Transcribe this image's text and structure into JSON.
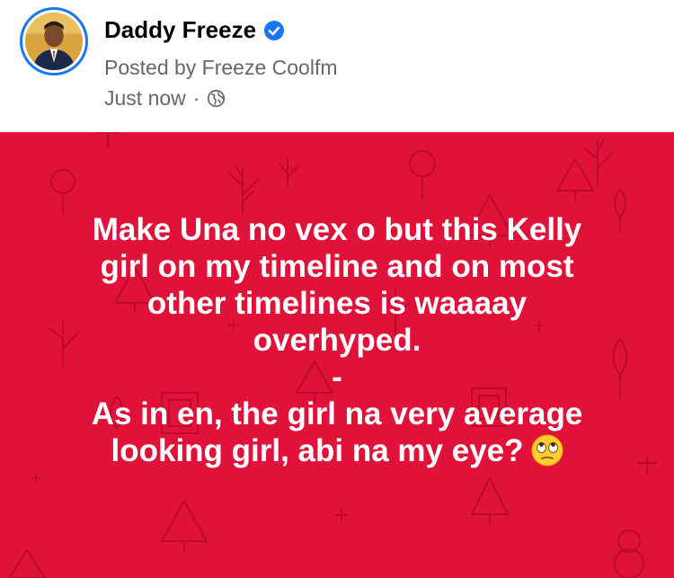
{
  "author": {
    "name": "Daddy Freeze",
    "verified": true,
    "posted_by": "Posted by Freeze Coolfm",
    "time": "Just now",
    "separator": "·",
    "audience_icon": "globe-icon"
  },
  "post": {
    "background_color": "#e0123a",
    "text_color": "#ffffff",
    "lines": [
      "Make Una no vex o but this Kelly",
      "girl on my timeline and on most",
      "other timelines is waaaay",
      "overhyped.",
      "-",
      "As in en, the girl na very average",
      "looking girl, abi na my eye?"
    ],
    "emoji": "face-with-rolling-eyes-icon"
  },
  "colors": {
    "brand_blue": "#1877f2",
    "secondary_text": "#65676b"
  }
}
